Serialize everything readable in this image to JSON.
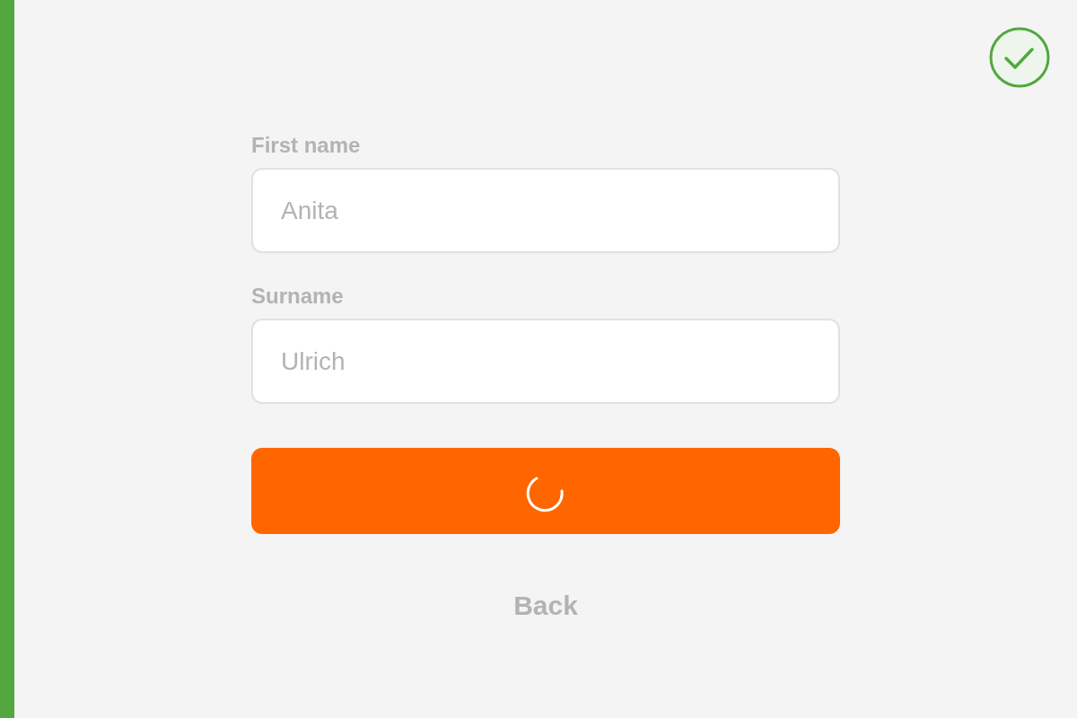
{
  "status": {
    "kind": "success"
  },
  "form": {
    "disabled": true,
    "fields": [
      {
        "label": "First name",
        "value": "Anita"
      },
      {
        "label": "Surname",
        "value": "Ulrich"
      }
    ],
    "submit": {
      "loading": true
    },
    "back": {
      "label": "Back"
    }
  }
}
